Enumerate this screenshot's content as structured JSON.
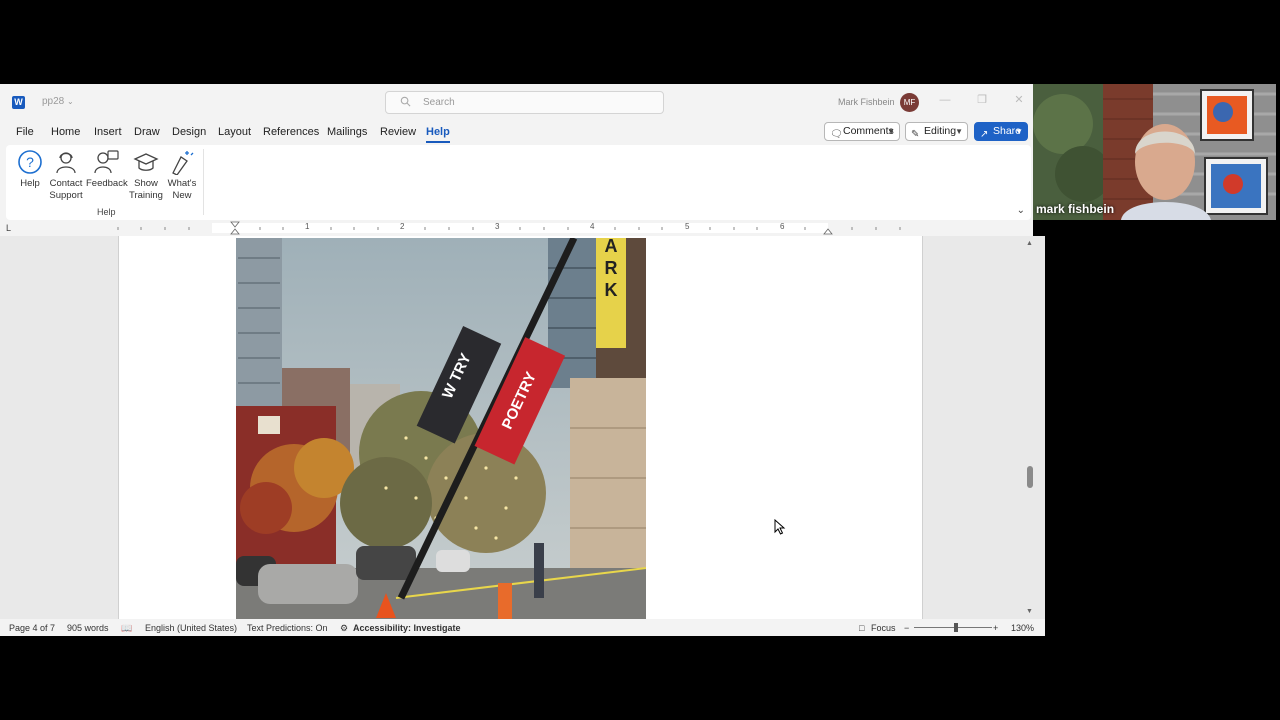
{
  "window": {
    "document_name": "pp28",
    "search_placeholder": "Search",
    "user_name": "Mark Fishbein",
    "user_initials": "MF"
  },
  "menu": {
    "tabs": [
      "File",
      "Home",
      "Insert",
      "Draw",
      "Design",
      "Layout",
      "References",
      "Mailings",
      "Review",
      "Help"
    ],
    "active_tab": "Help",
    "comments_label": "Comments",
    "editing_label": "Editing",
    "share_label": "Share"
  },
  "ribbon": {
    "buttons": [
      {
        "label1": "Help",
        "label2": ""
      },
      {
        "label1": "Contact",
        "label2": "Support"
      },
      {
        "label1": "Feedback",
        "label2": ""
      },
      {
        "label1": "Show",
        "label2": "Training"
      },
      {
        "label1": "What's",
        "label2": "New"
      }
    ],
    "group_label": "Help"
  },
  "ruler": {
    "numbers": [
      "1",
      "2",
      "3",
      "4",
      "5",
      "6"
    ],
    "left_marker": "L"
  },
  "status": {
    "page": "Page 4 of 7",
    "words": "905 words",
    "language": "English (United States)",
    "text_predictions": "Text Predictions: On",
    "accessibility": "Accessibility: Investigate",
    "focus": "Focus",
    "zoom_out": "−",
    "zoom_in": "+",
    "zoom": "130%",
    "zoom_fraction": 0.53
  },
  "photo": {
    "sign_left": "W TRY",
    "sign_right": "POETRY",
    "sign_park": "PARK"
  },
  "video": {
    "presenter_name": "mark fishbein"
  },
  "colors": {
    "accent": "#185abd",
    "share": "#1e62c6"
  }
}
